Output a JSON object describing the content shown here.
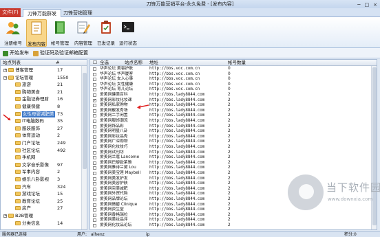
{
  "window": {
    "title": "刀锋万能营销平台-永久免费 - [发布内容]",
    "controls": [
      "─",
      "□",
      "×"
    ]
  },
  "ribbon_tabs": {
    "file": "文件(F)",
    "tab1": "刀锋万能群发",
    "tab2": "刀锋营销管理"
  },
  "ribbon": {
    "register": "注册帐号",
    "publish": "发布内容",
    "accounts": "帐号管理",
    "content": "内容管理",
    "published": "已发记录",
    "status": "运行状态"
  },
  "toolbar": {
    "start": "开始发布",
    "captcha": "验证码及验证邮箱配置"
  },
  "left": {
    "header_name": "站点列表",
    "header_count": "#",
    "rows": [
      {
        "name": "博客管理",
        "count": "17"
      },
      {
        "name": "论坛管理",
        "count": "1550"
      },
      {
        "name": "旅游",
        "count": "21"
      },
      {
        "name": "购物美食",
        "count": "21"
      },
      {
        "name": "金融证券理财",
        "count": "16"
      },
      {
        "name": "健康保健",
        "count": "8"
      },
      {
        "name": "女性母婴减肥美",
        "count": "73"
      },
      {
        "name": "IT电脑数码",
        "count": "35"
      },
      {
        "name": "服装服饰",
        "count": "27"
      },
      {
        "name": "体育运动",
        "count": "2"
      },
      {
        "name": "门户论坛",
        "count": "249"
      },
      {
        "name": "社区论坛",
        "count": "492"
      },
      {
        "name": "手机网",
        "count": ""
      },
      {
        "name": "文学音乐影像",
        "count": "97"
      },
      {
        "name": "军事内容",
        "count": "2"
      },
      {
        "name": "娱乐八卦影视",
        "count": "3"
      },
      {
        "name": "汽车",
        "count": "324"
      },
      {
        "name": "游戏论坛",
        "count": "15"
      },
      {
        "name": "教育论坛",
        "count": "25"
      },
      {
        "name": "房产",
        "count": "27"
      },
      {
        "name": "B2B管理",
        "count": ""
      },
      {
        "name": "分类信息",
        "count": "14"
      }
    ]
  },
  "right": {
    "header_all": "全选",
    "header_site": "站点名称",
    "header_addr": "地址",
    "header_count": "帐号数量",
    "rows": [
      {
        "site": "华声论坛 美容护肤",
        "addr": "http://bbs.voc.com.cn",
        "count": "0",
        "checked": false
      },
      {
        "site": "华声论坛 华声厦客",
        "addr": "http://bbs.voc.com.cn",
        "count": "0",
        "checked": false
      },
      {
        "site": "华声论坛 女人心事",
        "addr": "http://bbs.voc.com.cn",
        "count": "0",
        "checked": false
      },
      {
        "site": "华声论坛 女性健康",
        "addr": "http://bbs.voc.com.cn",
        "count": "0",
        "checked": false
      },
      {
        "site": "华声论坛 育儿论坛",
        "addr": "http://bbs.voc.com.cn",
        "count": "0",
        "checked": false
      },
      {
        "site": "爱美网健美百科",
        "addr": "http://bbs.lady8844.com",
        "count": "2",
        "checked": false
      },
      {
        "site": "爱美网彩妆化妆课",
        "addr": "http://bbs.lady8844.com",
        "count": "2",
        "checked": true
      },
      {
        "site": "爱美网私家购物",
        "addr": "http://bbs.lady8844.com",
        "count": "2",
        "checked": false
      },
      {
        "site": "爱美网靓发秀场",
        "addr": "http://bbs.lady8844.com",
        "count": "2",
        "checked": false
      },
      {
        "site": "爱美网二手闲置",
        "addr": "http://bbs.lady8844.com",
        "count": "2",
        "checked": false
      },
      {
        "site": "爱美网服饰潮流",
        "addr": "http://bbs.lady8844.com",
        "count": "2",
        "checked": false
      },
      {
        "site": "爱美网饰品彩",
        "addr": "http://bbs.lady8844.com",
        "count": "2",
        "checked": false
      },
      {
        "site": "爱美网明星八卦",
        "addr": "http://bbs.lady8844.com",
        "count": "2",
        "checked": false
      },
      {
        "site": "爱美网彩妆品秀",
        "addr": "http://bbs.lady8844.com",
        "count": "2",
        "checked": false
      },
      {
        "site": "爱美网广深购物",
        "addr": "http://bbs.lady8844.com",
        "count": "2",
        "checked": false
      },
      {
        "site": "爱美网化妆技巧",
        "addr": "http://bbs.lady8844.com",
        "count": "2",
        "checked": false
      },
      {
        "site": "爱美网试刊坊",
        "addr": "http://bbs.lady8844.com",
        "count": "2",
        "checked": false
      },
      {
        "site": "爱美网兰蔻 Lancome",
        "addr": "http://bbs.lady8844.com",
        "count": "2",
        "checked": false
      },
      {
        "site": "爱美网巴黎欧莱雅",
        "addr": "http://bbs.lady8844.com",
        "count": "2",
        "checked": false
      },
      {
        "site": "爱美网雅诗兰黛 Lou",
        "addr": "http://bbs.lady8844.com",
        "count": "2",
        "checked": false
      },
      {
        "site": "爱美网美宝莲 Maybell",
        "addr": "http://bbs.lady8844.com",
        "count": "2",
        "checked": false
      },
      {
        "site": "爱美网美发护发",
        "addr": "http://bbs.lady8844.com",
        "count": "2",
        "checked": false
      },
      {
        "site": "爱美网美容护肤",
        "addr": "http://bbs.lady8844.com",
        "count": "2",
        "checked": false
      },
      {
        "site": "爱美网完美减肥",
        "addr": "http://bbs.lady8844.com",
        "count": "2",
        "checked": false
      },
      {
        "site": "爱美网外贸代购",
        "addr": "http://bbs.lady8844.com",
        "count": "2",
        "checked": false
      },
      {
        "site": "爱美网品牌论坛",
        "addr": "http://bbs.lady8844.com",
        "count": "2",
        "checked": false
      },
      {
        "site": "爱美网倩碧 Clinique",
        "addr": "http://bbs.lady8844.com",
        "count": "2",
        "checked": false
      },
      {
        "site": "爱美网资生堂",
        "addr": "http://bbs.lady8844.com",
        "count": "2",
        "checked": false
      },
      {
        "site": "爱美网香格瑞拉",
        "addr": "http://bbs.lady8844.com",
        "count": "2",
        "checked": false
      },
      {
        "site": "爱美网美妆品评",
        "addr": "http://bbs.lady8844.com",
        "count": "2",
        "checked": false
      },
      {
        "site": "爱美网化妆品论坛",
        "addr": "http://bbs.lady8844.com",
        "count": "2",
        "checked": false
      }
    ]
  },
  "status": {
    "server": "服务器已连接",
    "user_label": "用户:",
    "user": "alhenz",
    "ip_label": "ip",
    "points": "积分:0"
  },
  "watermark": {
    "title": "当下软件园",
    "url": "www.downxia.com"
  },
  "colors": {
    "accent": "#3d78c8",
    "file_tab": "#c8382c",
    "arrow": "#e02020"
  }
}
